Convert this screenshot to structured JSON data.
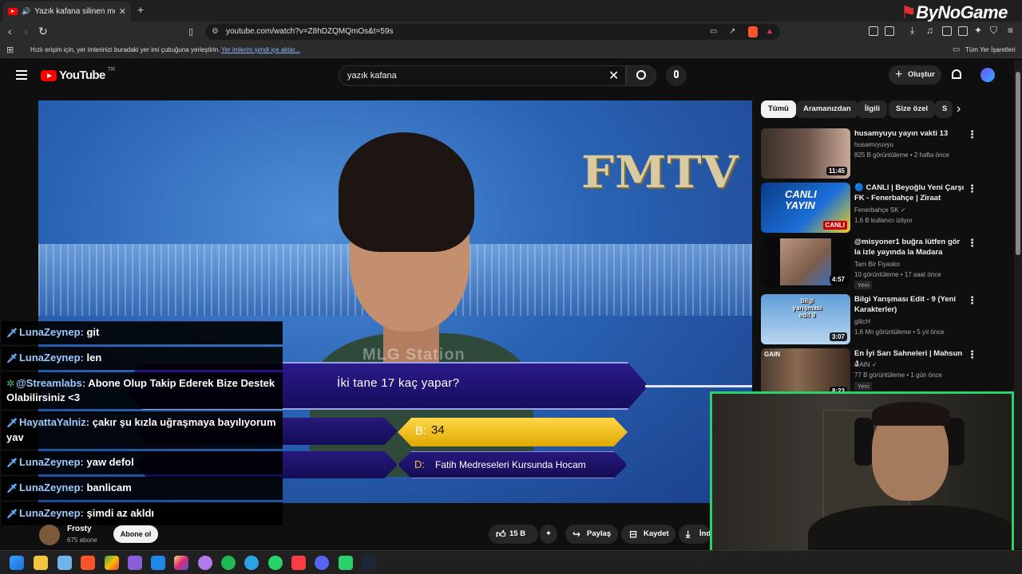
{
  "browser": {
    "tab_title": "Yazık kafana silinen montaj -",
    "url": "youtube.com/watch?v=Z8hDZQMQmOs&t=59s",
    "bookmarks_hint": "Hızlı erişim için, yer imlerinizi buradaki yer imi çubuğuna yerleştirin.",
    "bookmarks_link": "Yer imlerini şimdi içe aktar...",
    "all_bookmarks": "Tüm Yer İşaretleri",
    "watermark": "ByNoGame"
  },
  "youtube": {
    "logo_text": "YouTube",
    "country": "TR",
    "search_value": "yazık kafana",
    "create_label": "Oluştur"
  },
  "video": {
    "station_logo": "FMTV",
    "station_watermark": "MLG Station",
    "question": "İki tane 17 kaç yapar?",
    "option_b_letter": "B:",
    "option_b_value": "34",
    "option_d_letter": "D:",
    "option_d_value": "Fatih Medreseleri Kursunda Hocam"
  },
  "chat": [
    {
      "name": "LunaZeynep:",
      "text": " git",
      "icon": "sword"
    },
    {
      "name": "LunaZeynep:",
      "text": " len",
      "icon": "sword"
    },
    {
      "name": "@Streamlabs:",
      "text": " Abone Olup Takip Ederek Bize Destek Olabilirsiniz <3",
      "icon": "gear"
    },
    {
      "name": "HayattaYalniz:",
      "text": " çakır şu kızla uğraşmaya bayılıyorum yav",
      "icon": "sword"
    },
    {
      "name": "LunaZeynep:",
      "text": " yaw defol",
      "icon": "sword"
    },
    {
      "name": "LunaZeynep:",
      "text": " banlicam",
      "icon": "sword"
    },
    {
      "name": "LunaZeynep:",
      "text": " şimdi az akldı",
      "icon": "sword"
    }
  ],
  "channel": {
    "name": "Frosty",
    "subs": "675 abone",
    "subscribe_label": "Abone ol"
  },
  "actions": {
    "likes": "15 B",
    "share": "Paylaş",
    "save": "Kaydet",
    "download": "İnd"
  },
  "chips": [
    "Tümü",
    "Aramanızdan",
    "İlgili",
    "Size özel",
    "S"
  ],
  "recommendations": [
    {
      "title": "husamyuyu yayın vakti 13",
      "channel": "husamvyuvyu",
      "meta": "825 B görüntüleme • 2 hafta önce",
      "duration": "11:45",
      "badge": ""
    },
    {
      "title": "🔵 CANLI | Beyoğlu Yeni Çarşı FK - Fenerbahçe | Ziraat Türkiy...",
      "channel": "Fenerbahçe SK ✓",
      "meta": "1,6 B kullanıcı izliyor",
      "duration": "",
      "live": "CANLI",
      "thumb_text": "CANLI YAYIN",
      "badge": ""
    },
    {
      "title": "@misyoner1  buğra lütfen gör la izle yayında la Madara olduk ...",
      "channel": "Tam Bir Fiyasko",
      "meta": "10 görüntüleme • 17 saat önce",
      "duration": "4:57",
      "badge": "Yeni"
    },
    {
      "title": "Bilgi Yarışması Edit - 9 (Yeni Karakterler)",
      "channel": "glitcH",
      "meta": "1,6 Mn görüntüleme • 5 yıl önce",
      "duration": "3:07",
      "thumb_text": "bilgi yarışması edit 9",
      "badge": ""
    },
    {
      "title": "En İyi Sarı Sahneleri | Mahsun J",
      "channel": "GAIN ✓",
      "meta": "77 B görüntüleme • 1 gün önce",
      "duration": "8:23",
      "thumb_text": "GAIN",
      "badge": "Yeni"
    }
  ],
  "colors": {
    "accent_red": "#ff0000",
    "webcam_border": "#2ad16a",
    "chat_name": "#9ecbff"
  }
}
